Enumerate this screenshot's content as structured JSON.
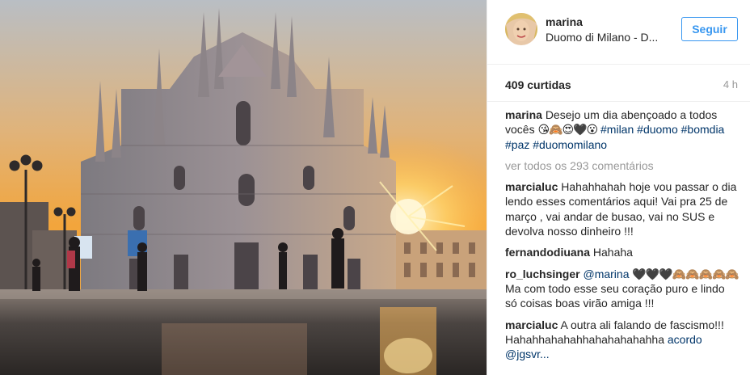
{
  "post": {
    "username": "marina",
    "location": "Duomo di Milano - D...",
    "follow_label": "Seguir",
    "likes": "409 curtidas",
    "time_ago": "4 h",
    "caption": {
      "author": "marina",
      "text": "Desejo um dia abençoado a todos vocês",
      "emojis": "😘🙈😍🖤😮",
      "hashtags": [
        "#milan",
        "#duomo",
        "#bomdia",
        "#paz",
        "#duomomilano"
      ]
    },
    "view_all_label": "ver todos os 293 comentários",
    "comments": [
      {
        "author": "marcialuc",
        "text": "Hahahhahah hoje vou passar o dia lendo esses comentários aqui! Vai pra 25 de março , vai andar de busao, vai no SUS e devolva nosso dinheiro !!!"
      },
      {
        "author": "fernandodiuana",
        "text": "Hahaha"
      },
      {
        "author": "ro_luchsinger",
        "mention": "@marina",
        "emojis": "🖤🖤🖤🙈🙈🙈🙈🙈",
        "text": "Ma com todo esse seu coração puro e lindo só coisas boas virão amiga !!!"
      },
      {
        "author": "marcialuc",
        "text": "A outra ali falando de fascismo!!! Hahahhahahahhahahahahahha",
        "tail": "acordo @jgsvr..."
      }
    ]
  },
  "colors": {
    "link": "#003569",
    "button": "#3897f0",
    "muted": "#999999"
  },
  "icons": {
    "avatar": "avatar-photo"
  }
}
